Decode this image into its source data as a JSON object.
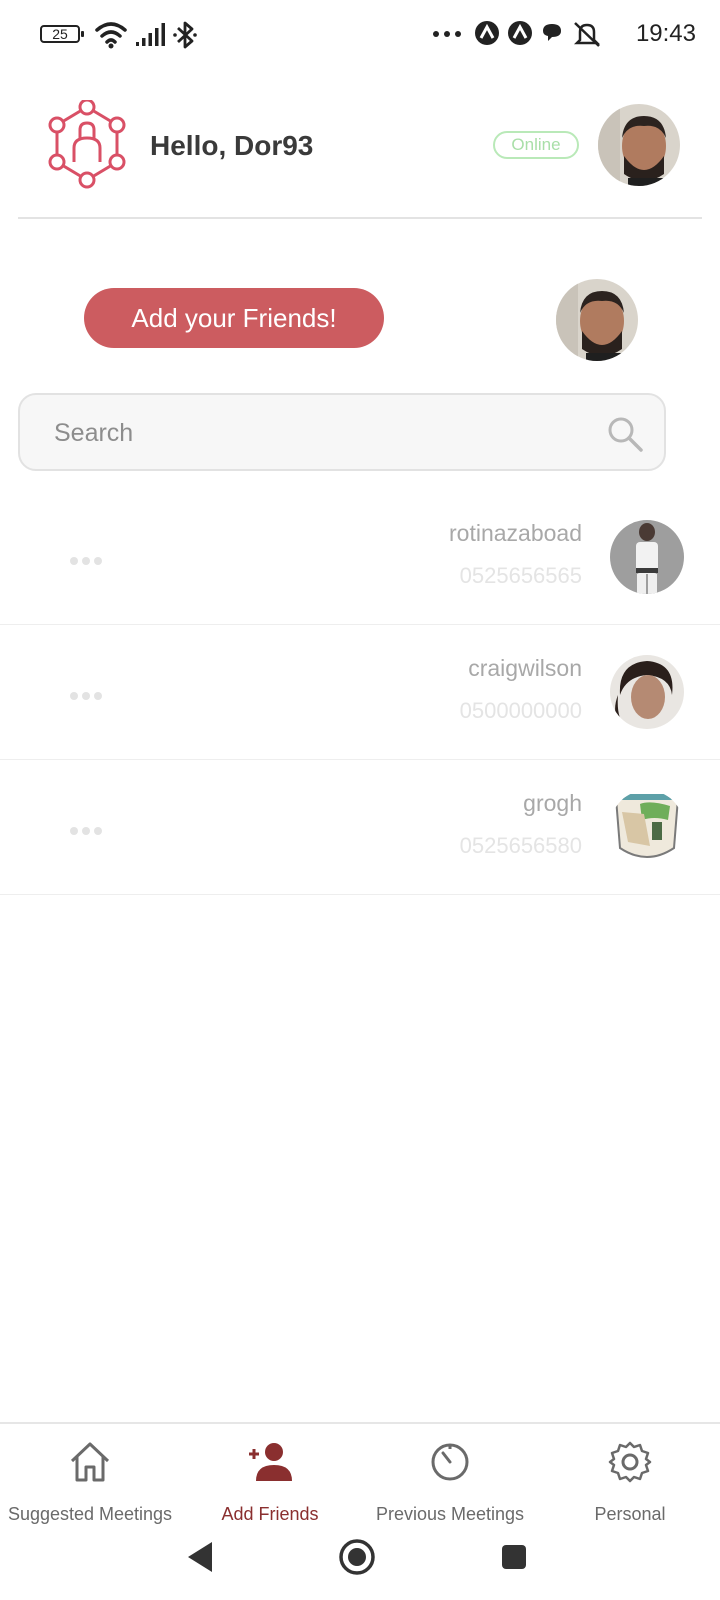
{
  "status_bar": {
    "battery": "25",
    "time": "19:43",
    "icons": [
      "wifi-icon",
      "signal-icon",
      "bluetooth-icon",
      "more-icon",
      "app-a-icon",
      "app-a2-icon",
      "chat-icon",
      "silent-icon"
    ]
  },
  "header": {
    "greeting": "Hello, Dor93",
    "status": "Online",
    "logo_icon": "network-person-icon"
  },
  "add_friends_button": "Add your Friends!",
  "search": {
    "placeholder": "Search"
  },
  "friends": [
    {
      "name": "rotinazaboad",
      "phone": "0525656565"
    },
    {
      "name": "craigwilson",
      "phone": "0500000000"
    },
    {
      "name": "grogh",
      "phone": "0525656580"
    }
  ],
  "bottom_nav": {
    "items": [
      {
        "label": "Suggested Meetings",
        "icon": "home-icon"
      },
      {
        "label": "Add Friends",
        "icon": "add-person-icon",
        "active": true
      },
      {
        "label": "Previous Meetings",
        "icon": "timer-icon"
      },
      {
        "label": "Personal",
        "icon": "gear-icon"
      }
    ]
  },
  "colors": {
    "accent": "#cc5c60",
    "active_nav": "#8a2f2f",
    "online": "#b9e9b8"
  }
}
